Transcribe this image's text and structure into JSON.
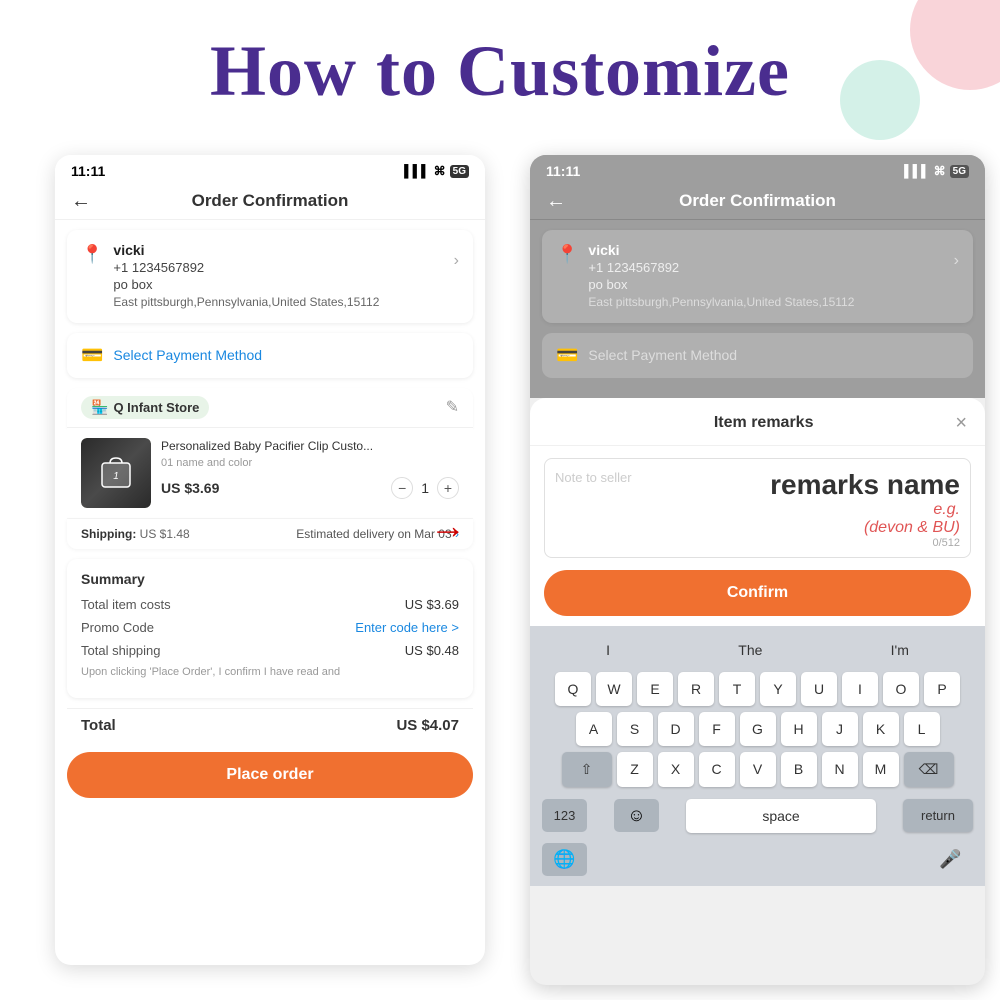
{
  "page": {
    "title": "How to Customize",
    "bg_circle_colors": {
      "pink": "#f5b8c0",
      "mint": "#b8e8d8"
    }
  },
  "left_phone": {
    "status_bar": {
      "time": "11:11",
      "signal": "▌▌▌",
      "wifi": "WiFi",
      "network": "5G"
    },
    "header": {
      "back_label": "←",
      "title": "Order Confirmation"
    },
    "address": {
      "name": "vicki",
      "phone": "+1 1234567892",
      "pobox": "po box",
      "location": "East pittsburgh,Pennsylvania,United States,15112"
    },
    "payment": {
      "label": "Select Payment Method"
    },
    "store": {
      "name": "Q Infant Store"
    },
    "product": {
      "name": "Personalized Baby Pacifier Clip Custo...",
      "variant": "01 name and color",
      "price": "US $3.69",
      "quantity": "1"
    },
    "shipping": {
      "label": "Shipping:",
      "cost": "US $1.48",
      "delivery": "Estimated delivery on Mar 03"
    },
    "summary": {
      "title": "Summary",
      "item_cost_label": "Total item costs",
      "item_cost_val": "US $3.69",
      "promo_label": "Promo Code",
      "promo_val": "Enter code here >",
      "shipping_label": "Total shipping",
      "shipping_val": "US $0.48",
      "disclaimer": "Upon clicking 'Place Order', I confirm I have read and",
      "total_label": "Total",
      "total_val": "US $4.07"
    },
    "place_order_btn": "Place order"
  },
  "right_phone": {
    "status_bar": {
      "time": "11:11",
      "signal": "▌▌▌",
      "wifi": "WiFi",
      "network": "5G"
    },
    "header": {
      "back_label": "←",
      "title": "Order Confirmation"
    },
    "address": {
      "name": "vicki",
      "phone": "+1 1234567892",
      "pobox": "po box",
      "location": "East pittsburgh,Pennsylvania,United States,15112"
    },
    "payment": {
      "label": "Select Payment Method"
    },
    "modal": {
      "title": "Item remarks",
      "close_label": "×",
      "placeholder": "Note to seller",
      "remarks_name": "remarks name",
      "remarks_eg": "e.g.",
      "remarks_example": "(devon & BU)",
      "char_count": "0/512",
      "confirm_label": "Confirm"
    },
    "keyboard": {
      "suggestions": [
        "I",
        "The",
        "I'm"
      ],
      "row1": [
        "Q",
        "W",
        "E",
        "R",
        "T",
        "Y",
        "U",
        "I",
        "O",
        "P"
      ],
      "row2": [
        "A",
        "S",
        "D",
        "F",
        "G",
        "H",
        "J",
        "K",
        "L"
      ],
      "row3": [
        "Z",
        "X",
        "C",
        "V",
        "B",
        "N",
        "M"
      ],
      "num_label": "123",
      "space_label": "space",
      "return_label": "return"
    }
  },
  "arrow": {
    "symbol": "➜"
  }
}
